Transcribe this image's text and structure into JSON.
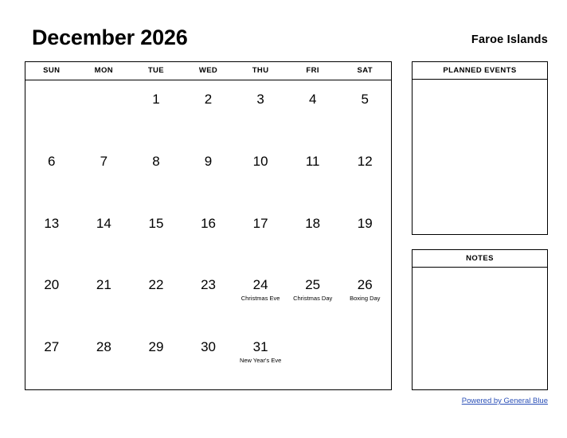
{
  "header": {
    "title": "December 2026",
    "locale": "Faroe Islands"
  },
  "calendar": {
    "weekdays": [
      "SUN",
      "MON",
      "TUE",
      "WED",
      "THU",
      "FRI",
      "SAT"
    ],
    "weeks": [
      [
        {
          "day": "",
          "event": ""
        },
        {
          "day": "",
          "event": ""
        },
        {
          "day": "1",
          "event": ""
        },
        {
          "day": "2",
          "event": ""
        },
        {
          "day": "3",
          "event": ""
        },
        {
          "day": "4",
          "event": ""
        },
        {
          "day": "5",
          "event": ""
        }
      ],
      [
        {
          "day": "6",
          "event": ""
        },
        {
          "day": "7",
          "event": ""
        },
        {
          "day": "8",
          "event": ""
        },
        {
          "day": "9",
          "event": ""
        },
        {
          "day": "10",
          "event": ""
        },
        {
          "day": "11",
          "event": ""
        },
        {
          "day": "12",
          "event": ""
        }
      ],
      [
        {
          "day": "13",
          "event": ""
        },
        {
          "day": "14",
          "event": ""
        },
        {
          "day": "15",
          "event": ""
        },
        {
          "day": "16",
          "event": ""
        },
        {
          "day": "17",
          "event": ""
        },
        {
          "day": "18",
          "event": ""
        },
        {
          "day": "19",
          "event": ""
        }
      ],
      [
        {
          "day": "20",
          "event": ""
        },
        {
          "day": "21",
          "event": ""
        },
        {
          "day": "22",
          "event": ""
        },
        {
          "day": "23",
          "event": ""
        },
        {
          "day": "24",
          "event": "Christmas Eve"
        },
        {
          "day": "25",
          "event": "Christmas Day"
        },
        {
          "day": "26",
          "event": "Boxing Day"
        }
      ],
      [
        {
          "day": "27",
          "event": ""
        },
        {
          "day": "28",
          "event": ""
        },
        {
          "day": "29",
          "event": ""
        },
        {
          "day": "30",
          "event": ""
        },
        {
          "day": "31",
          "event": "New Year's Eve"
        },
        {
          "day": "",
          "event": ""
        },
        {
          "day": "",
          "event": ""
        }
      ]
    ]
  },
  "panels": {
    "planned_events": {
      "title": "PLANNED EVENTS",
      "content": ""
    },
    "notes": {
      "title": "NOTES",
      "content": ""
    }
  },
  "footer": {
    "link_label": "Powered by General Blue",
    "link_color": "#2a4fb7"
  }
}
